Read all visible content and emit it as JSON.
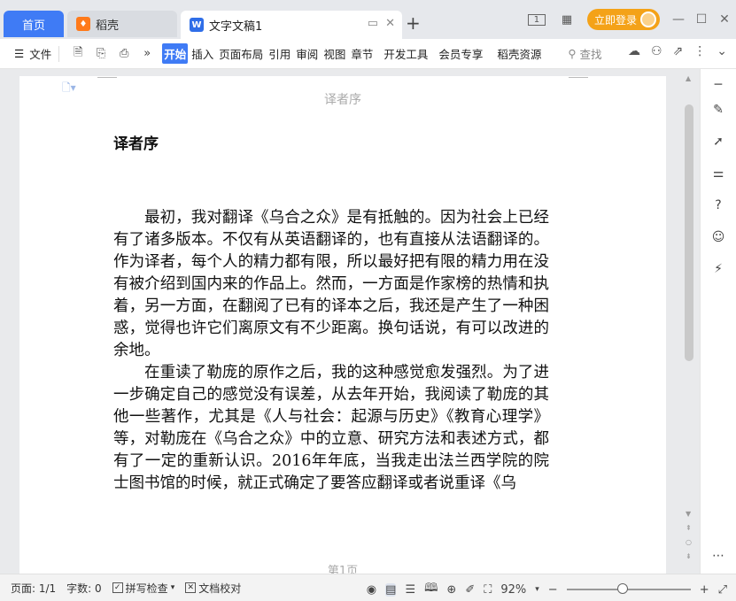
{
  "tabs": {
    "home": "首页",
    "daoke": "稻壳",
    "doc": "文字文稿1",
    "new_tab": "+"
  },
  "title_right": {
    "login": "立即登录",
    "page_ind": "1"
  },
  "toolbar": {
    "file": "文件",
    "more": "»",
    "ribbon": [
      "开始",
      "插入",
      "页面布局",
      "引用",
      "审阅",
      "视图",
      "章节",
      "开发工具",
      "会员专享",
      "稻壳资源"
    ],
    "search": "查找"
  },
  "document": {
    "header": "译者序",
    "title": "译者序",
    "paragraphs": [
      "最初，我对翻译《乌合之众》是有抵触的。因为社会上已经有了诸多版本。不仅有从英语翻译的，也有直接从法语翻译的。作为译者，每个人的精力都有限，所以最好把有限的精力用在没有被介绍到国内来的作品上。然而，一方面是作家榜的热情和执着，另一方面，在翻阅了已有的译本之后，我还是产生了一种困惑，觉得也许它们离原文有不少距离。换句话说，有可以改进的余地。",
      "在重读了勒庞的原作之后，我的这种感觉愈发强烈。为了进一步确定自己的感觉没有误差，从去年开始，我阅读了勒庞的其他一些著作，尤其是《人与社会：起源与历史》《教育心理学》等，对勒庞在《乌合之众》中的立意、研究方法和表述方式，都有了一定的重新认识。2016年年底，当我走出法兰西学院的院士图书馆的时候，就正式确定了要答应翻译或者说重译《乌"
    ],
    "footer": "第1页"
  },
  "status": {
    "page": "页面: 1/1",
    "wordcount": "字数: 0",
    "spellcheck": "拼写检查",
    "proofread": "文档校对",
    "zoom": "92%",
    "zoom_level": 0.45
  }
}
